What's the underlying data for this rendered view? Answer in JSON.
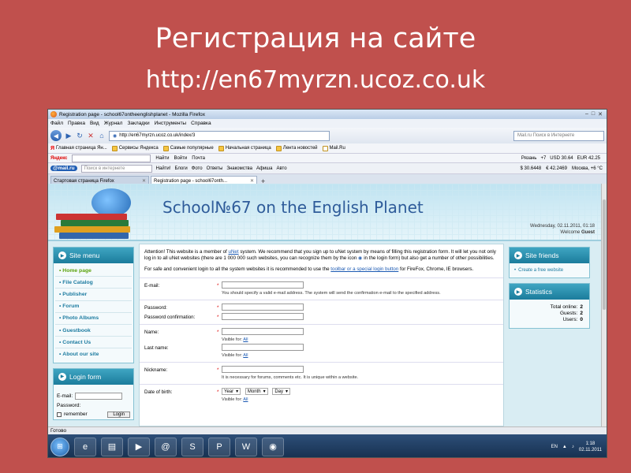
{
  "slide": {
    "title": "Регистрация на сайте",
    "url": "http://en67myrzn.ucoz.co.uk"
  },
  "browser": {
    "window_title": "Registration page - school67ontheenglishplanet - Mozilla Firefox",
    "menu": [
      "Файл",
      "Правка",
      "Вид",
      "Журнал",
      "Закладки",
      "Инструменты",
      "Справка"
    ],
    "address": "http://en67myrzn.ucoz.co.uk/index/3",
    "search_placeholder": "Mail.ru Поиск в Интернете",
    "bookmarks": [
      "Главная страница Ян...",
      "Сервисы Яндекса",
      "Самые популярные",
      "Начальная страница",
      "Лента новостей",
      "Mail.Ru"
    ],
    "yandex_toolbar": {
      "logo": "Яндекс",
      "find": "Найти",
      "items": [
        "Войти",
        "Почта"
      ],
      "weather_city": "Рязань",
      "temp": "+7",
      "usd": "USD 30.64",
      "eur": "EUR 42.25"
    },
    "mail_toolbar": {
      "logo": "@mail.ru",
      "search_placeholder": "Поиск в интернете",
      "find": "Найти!",
      "items": [
        "Блоги",
        "Фото",
        "Ответы",
        "Знакомства",
        "Афиша",
        "Авто"
      ],
      "rate1": "$ 30.6448",
      "rate2": "€ 42.2469",
      "city": "Москва, +6 °C"
    },
    "tabs": [
      {
        "label": "Стартовая страница Firefox"
      },
      {
        "label": "Registration page - school67onth..."
      }
    ],
    "status": "Готово"
  },
  "site": {
    "title": "School№67 on the English Planet",
    "date_line": "Wednesday, 02.11.2011, 01:18",
    "welcome_text": "Welcome",
    "welcome_user": "Guest",
    "site_menu_title": "Site menu",
    "menu_items": [
      "Home page",
      "File Catalog",
      "Publisher",
      "Forum",
      "Photo Albums",
      "Guestbook",
      "Contact Us",
      "About our site"
    ],
    "login_title": "Login form",
    "login_email_label": "E-mail:",
    "login_password_label": "Password:",
    "remember_label": "remember",
    "login_button": "Login",
    "friends_title": "Site friends",
    "friends_link": "Create a free website",
    "stats_title": "Statistics",
    "stats_total_label": "Total online:",
    "stats_total": "2",
    "stats_guests_label": "Guests:",
    "stats_guests": "2",
    "stats_users_label": "Users:",
    "stats_users": "0"
  },
  "content": {
    "attention_a": "Attention! This website is a member of",
    "attention_link": "uNet",
    "attention_b": "system. We recommend that you sign up to uNet system by means of filling this registration form. It will let you not only log in to all uNet websites (there are 1 000 000 such websites, you can recognize them by the icon",
    "attention_c": "in the login form) but also get a number of other possibilities.",
    "safe_a": "For safe and convenient login to all the system websites it is recommended to use the",
    "safe_link": "toolbar or a special login button",
    "safe_b": "for FireFox, Chrome, IE browsers.",
    "email_label": "E-mail:",
    "email_hint": "You should specify a valid e-mail address. The system will send the confirmation e-mail to the specified address.",
    "password_label": "Password:",
    "password_confirm_label": "Password confirmation:",
    "name_label": "Name:",
    "visible_for": "Visible for:",
    "visible_all": "All",
    "lastname_label": "Last name:",
    "nickname_label": "Nickname:",
    "nickname_hint": "It is necessary for forums, comments etc. It is unique within a website.",
    "dob_label": "Date of birth:",
    "dob_year": "Year",
    "dob_month": "Month",
    "dob_day": "Day"
  },
  "taskbar": {
    "lang": "EN",
    "time": "1:18",
    "date": "02.11.2011"
  }
}
